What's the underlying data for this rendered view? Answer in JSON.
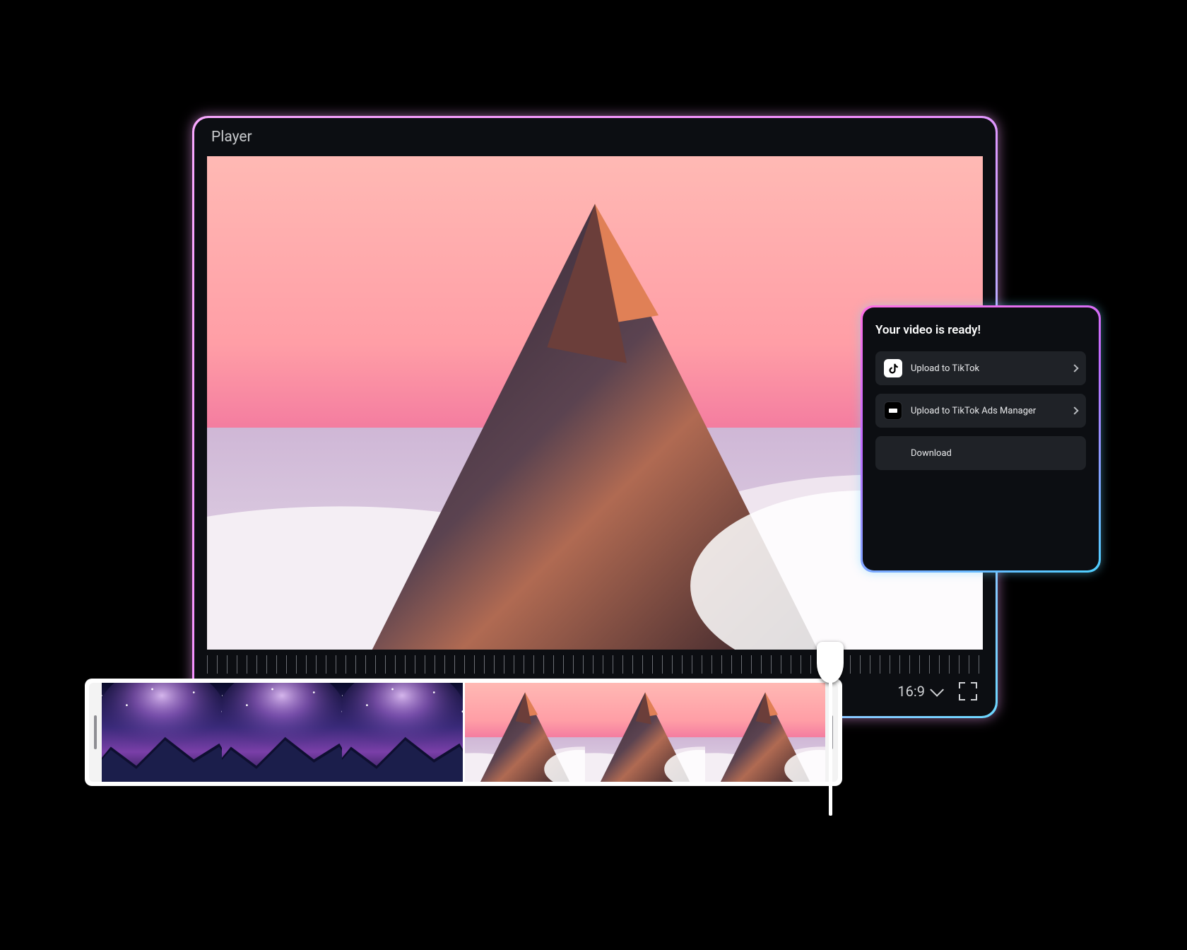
{
  "player": {
    "title": "Player",
    "aspect_ratio": "16:9"
  },
  "export": {
    "title": "Your video is ready!",
    "options": [
      {
        "icon": "tiktok",
        "label": "Upload to TikTok",
        "chevron": true
      },
      {
        "icon": "ads",
        "label": "Upload to TikTok Ads Manager",
        "chevron": true
      },
      {
        "icon": "download",
        "label": "Download",
        "chevron": false
      }
    ]
  },
  "timeline": {
    "clips": [
      {
        "kind": "night-mountain",
        "thumbs": 3
      },
      {
        "kind": "sunset-peak",
        "thumbs": 3
      }
    ]
  }
}
